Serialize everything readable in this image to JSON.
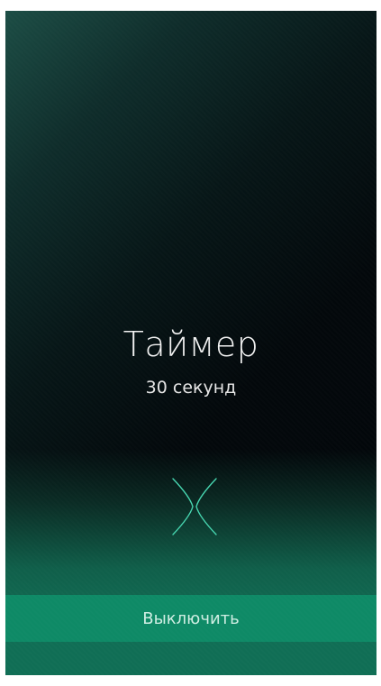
{
  "alarm": {
    "title": "Таймер",
    "subtitle": "30 секунд"
  },
  "action": {
    "dismiss_label": "Выключить"
  },
  "icons": {
    "center": "dismiss-chevrons-icon"
  },
  "colors": {
    "accent": "#0e8a66",
    "icon_stroke": "#46d6b0",
    "text": "#f2f2f2"
  }
}
